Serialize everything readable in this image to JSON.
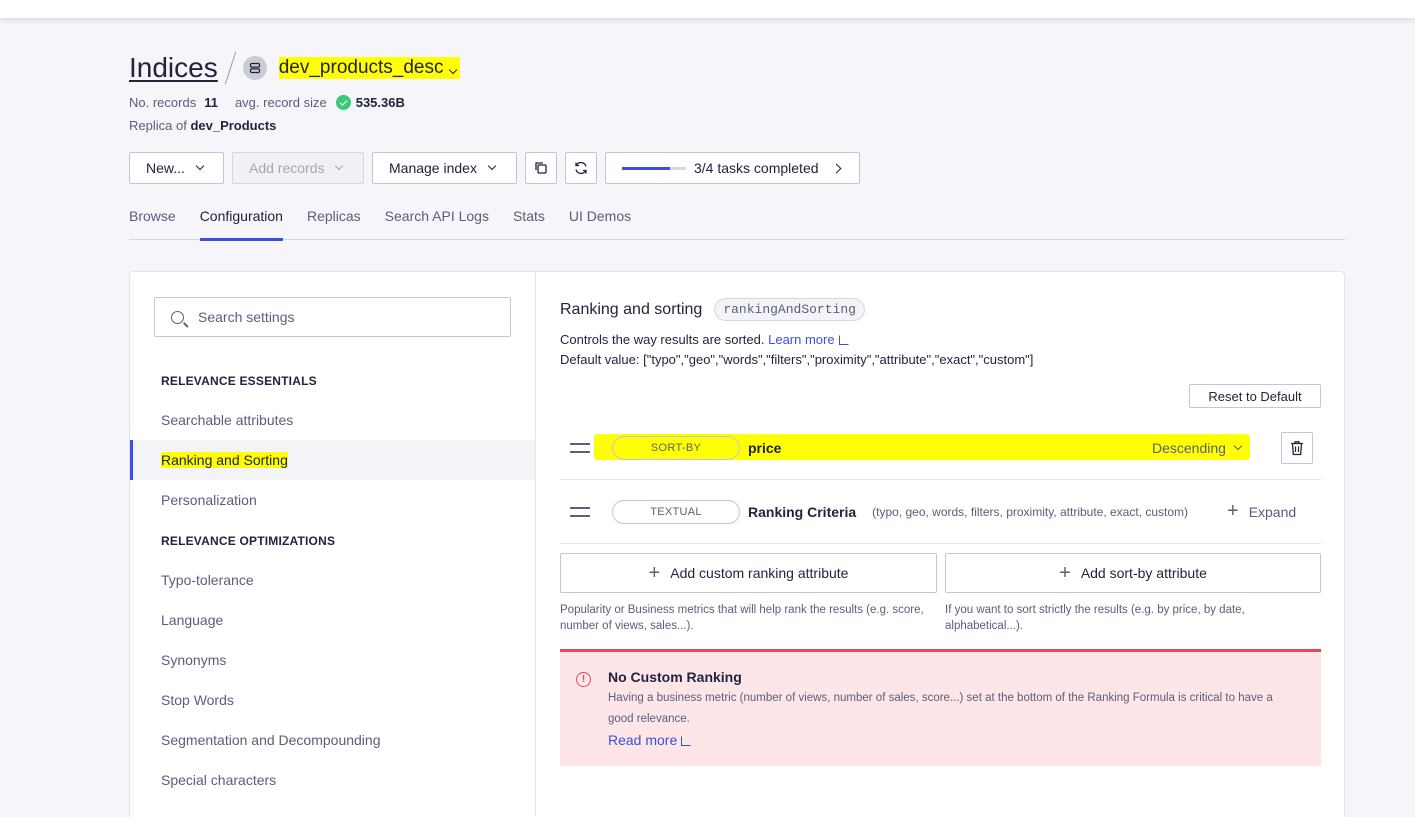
{
  "header": {
    "title": "Indices",
    "index_name": "dev_products_desc",
    "records_label": "No. records",
    "records_value": "11",
    "size_label": "avg. record size",
    "size_value": "535.36B",
    "replica_prefix": "Replica of",
    "replica_of": "dev_Products"
  },
  "toolbar": {
    "new_label": "New...",
    "add_records_label": "Add records",
    "manage_index_label": "Manage index",
    "tasks_label": "3/4 tasks completed",
    "tasks_progress": 0.75
  },
  "tabs": [
    "Browse",
    "Configuration",
    "Replicas",
    "Search API Logs",
    "Stats",
    "UI Demos"
  ],
  "active_tab": "Configuration",
  "sidebar": {
    "search_placeholder": "Search settings",
    "section1": "RELEVANCE ESSENTIALS",
    "items1": [
      "Searchable attributes",
      "Ranking and Sorting",
      "Personalization"
    ],
    "section2": "RELEVANCE OPTIMIZATIONS",
    "items2": [
      "Typo-tolerance",
      "Language",
      "Synonyms",
      "Stop Words",
      "Segmentation and Decompounding",
      "Special characters"
    ],
    "active_item": "Ranking and Sorting"
  },
  "content": {
    "title": "Ranking and sorting",
    "code": "rankingAndSorting",
    "desc": "Controls the way results are sorted.",
    "learn_more": "Learn more",
    "default_value": "Default value: [\"typo\",\"geo\",\"words\",\"filters\",\"proximity\",\"attribute\",\"exact\",\"custom\"]",
    "reset_label": "Reset to Default",
    "rows": [
      {
        "tag": "SORT-BY",
        "name": "price",
        "direction": "Descending"
      },
      {
        "tag": "TEXTUAL",
        "name": "Ranking Criteria",
        "note": "(typo, geo, words, filters, proximity, attribute, exact, custom)",
        "action": "Expand"
      }
    ],
    "add_custom_label": "Add custom ranking attribute",
    "add_sortby_label": "Add sort-by attribute",
    "help_custom": "Popularity or Business metrics that will help rank the results (e.g. score, number of views, sales...).",
    "help_sortby": "If you want to sort strictly the results (e.g. by price, by date, alphabetical...).",
    "alert": {
      "title": "No Custom Ranking",
      "text": "Having a business metric (number of views, number of sales, score...) set at the bottom of the Ranking Formula is critical to have a good relevance.",
      "link": "Read more"
    }
  },
  "colors": {
    "accent": "#3c4fe0",
    "highlight": "#ffff00",
    "alert_bg": "#fde5e8",
    "alert_border": "#e5475e",
    "success": "#3cc87a"
  }
}
